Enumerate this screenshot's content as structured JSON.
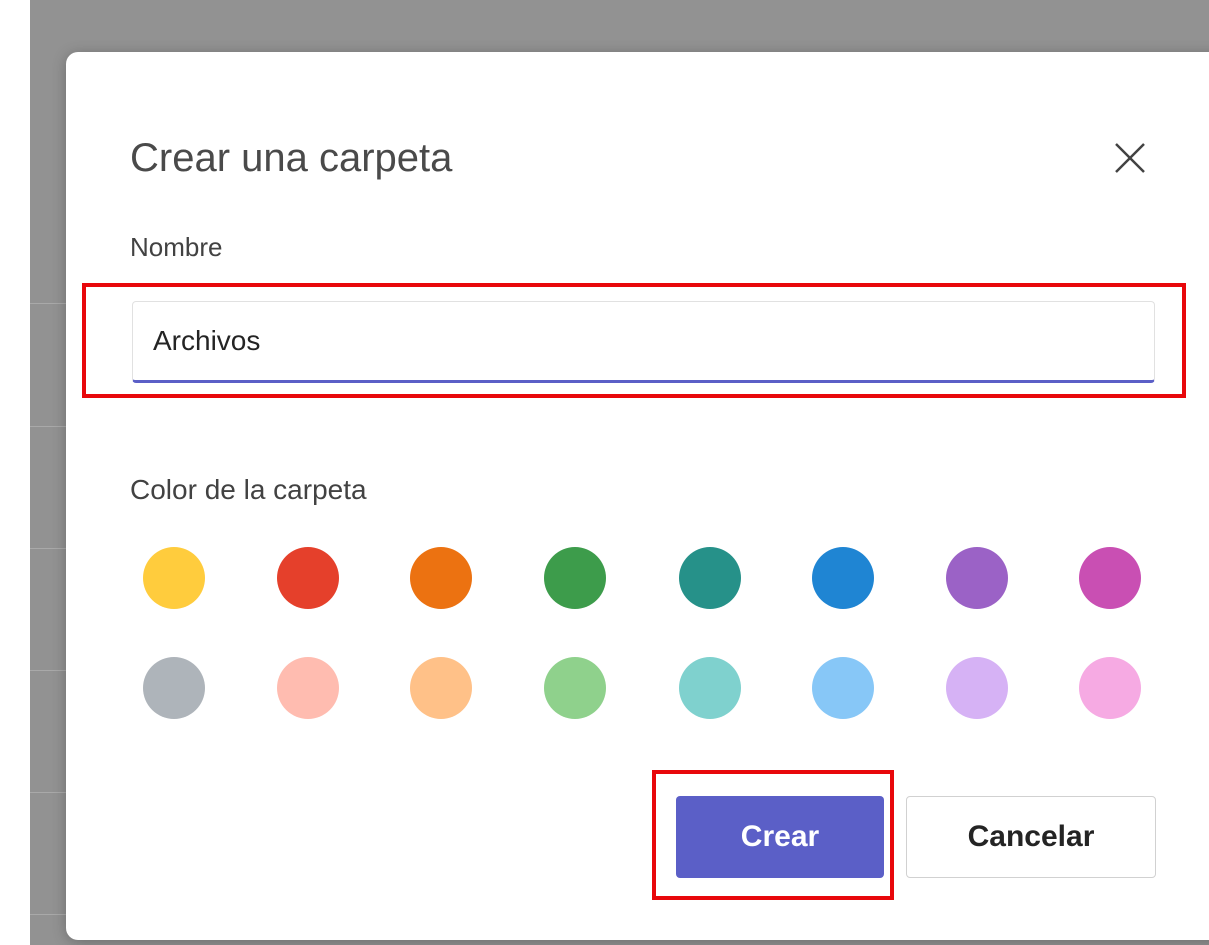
{
  "dialog": {
    "title": "Crear una carpeta",
    "close_icon": "close-icon",
    "name_label": "Nombre",
    "name_value": "Archivos",
    "color_label": "Color de la carpeta",
    "selected_color": "#ffcc3d",
    "colors_row1": [
      "#ffcc3d",
      "#e5402b",
      "#ec7211",
      "#3d9c4b",
      "#269189",
      "#1f85d3",
      "#9b62c6",
      "#c94fb3"
    ],
    "colors_row2": [
      "#aeb4ba",
      "#ffbcb0",
      "#ffc188",
      "#8fd18c",
      "#7fd1ce",
      "#87c7f7",
      "#d6b2f5",
      "#f6aae3"
    ],
    "create_label": "Crear",
    "cancel_label": "Cancelar",
    "accent_color": "#5b5fc7",
    "highlight_color": "#e8070b"
  }
}
